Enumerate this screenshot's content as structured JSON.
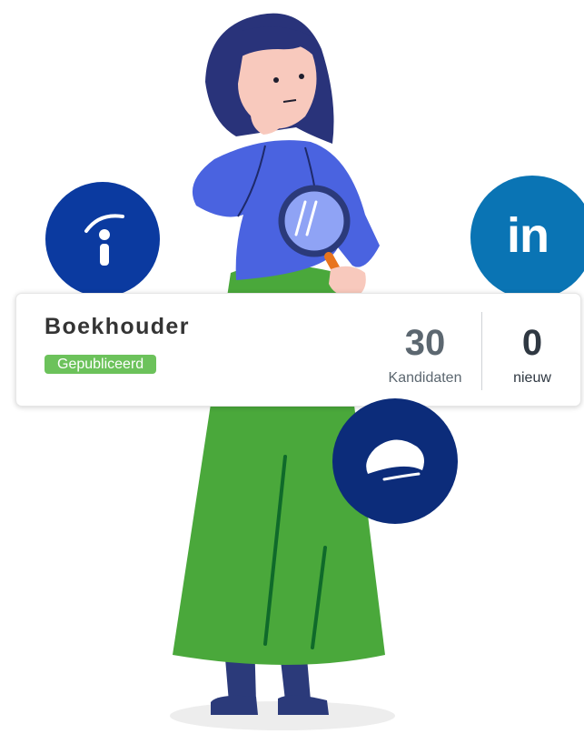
{
  "card": {
    "title": "Boekhouder",
    "status": "Gepubliceerd",
    "candidates_value": "30",
    "candidates_label": "Kandidaten",
    "new_value": "0",
    "new_label": "nieuw"
  },
  "logos": {
    "indeed": "indeed-logo-icon",
    "linkedin_text": "in",
    "werkzoeken": "werkzoeken-logo-icon"
  },
  "colors": {
    "indeed": "#0b3aa0",
    "linkedin": "#0a74b4",
    "werkzoeken": "#0c2c7a",
    "status_green": "#6cc25b",
    "skirt_green": "#4aa83b",
    "shirt_blue": "#4a63e0"
  }
}
